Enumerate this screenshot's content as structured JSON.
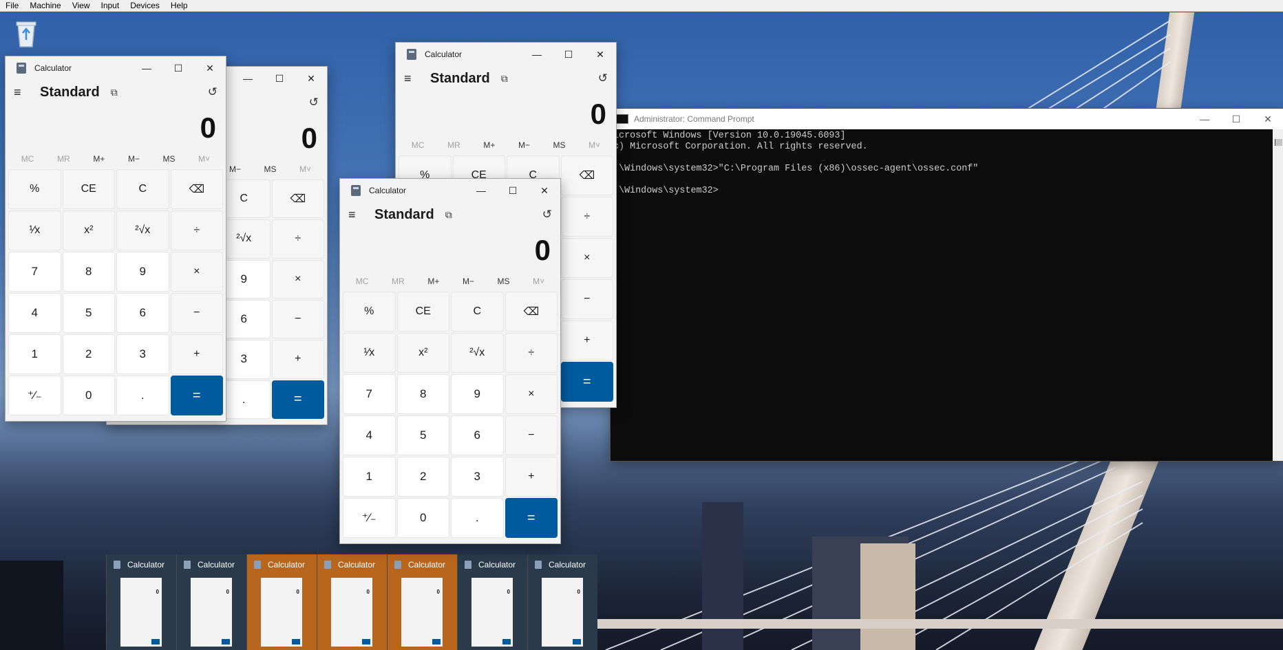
{
  "vm_menu": [
    "File",
    "Machine",
    "View",
    "Input",
    "Devices",
    "Help"
  ],
  "desktop": {
    "recycle_label": "Recycle Bin"
  },
  "calculator": {
    "title": "Calculator",
    "mode": "Standard",
    "display": "0",
    "memory": [
      "MC",
      "MR",
      "M+",
      "M−",
      "MS",
      "M˅"
    ],
    "keys": [
      "%",
      "CE",
      "C",
      "⌫",
      "¹⁄x",
      "x²",
      "²√x",
      "÷",
      "7",
      "8",
      "9",
      "×",
      "4",
      "5",
      "6",
      "−",
      "1",
      "2",
      "3",
      "+",
      "⁺⁄₋",
      "0",
      ".",
      "="
    ],
    "window_buttons": {
      "minimize": "—",
      "maximize": "☐",
      "close": "✕"
    },
    "icons": {
      "menu": "≡",
      "keep_on_top": "⧉",
      "history": "↺"
    }
  },
  "cmd": {
    "title": "Administrator: Command Prompt",
    "lines": [
      "icrosoft Windows [Version 10.0.19045.6093]",
      "c) Microsoft Corporation. All rights reserved.",
      "",
      ":\\Windows\\system32>\"C:\\Program Files (x86)\\ossec-agent\\ossec.conf\"",
      "",
      ":\\Windows\\system32>"
    ]
  },
  "taskbar_thumbnails": [
    {
      "label": "Calculator",
      "highlighted": false
    },
    {
      "label": "Calculator",
      "highlighted": false
    },
    {
      "label": "Calculator",
      "highlighted": true
    },
    {
      "label": "Calculator",
      "highlighted": true
    },
    {
      "label": "Calculator",
      "highlighted": true
    },
    {
      "label": "Calculator",
      "highlighted": false
    },
    {
      "label": "Calculator",
      "highlighted": false
    }
  ],
  "colors": {
    "accent": "#005a9e",
    "highlight": "#b8651e",
    "cmd_bg": "#0c0c0c"
  }
}
